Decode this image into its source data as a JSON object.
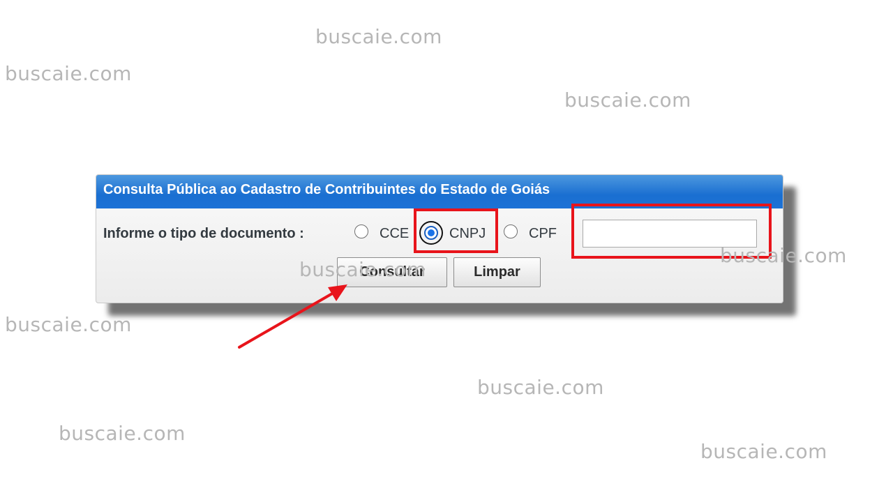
{
  "panel": {
    "title": "Consulta Pública ao Cadastro de Contribuintes do Estado de Goiás",
    "document_type_label": "Informe o tipo de documento :",
    "options": [
      {
        "label": "CCE",
        "selected": false
      },
      {
        "label": "CNPJ",
        "selected": true
      },
      {
        "label": "CPF",
        "selected": false
      }
    ],
    "document_input": {
      "value": "",
      "placeholder": ""
    },
    "buttons": {
      "consultar": "Consultar",
      "limpar": "Limpar"
    }
  },
  "watermark": "buscaie.com",
  "colors": {
    "header": "#1a6fd1",
    "annotation": "#e8141b",
    "watermark": "#b6b6b6"
  },
  "icons": [
    "radio-button-icon",
    "arrow-annotation-icon"
  ]
}
